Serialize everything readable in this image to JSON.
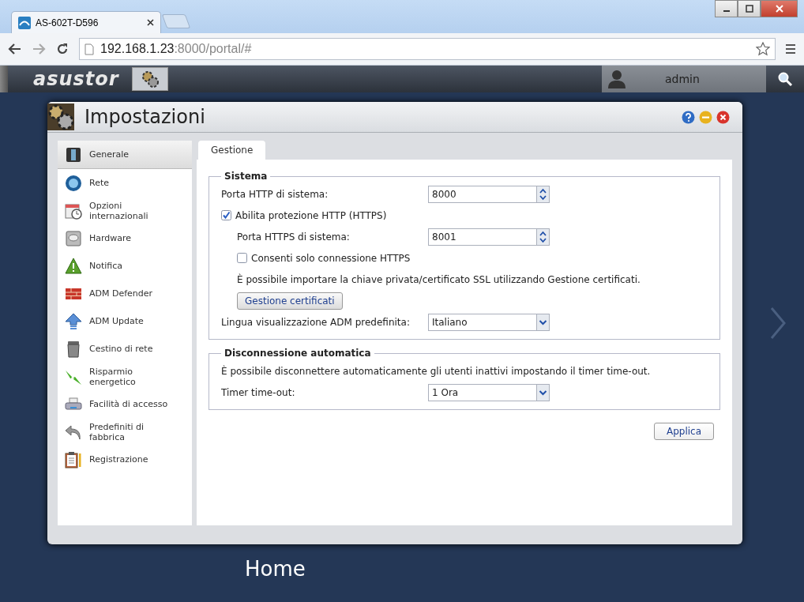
{
  "browser": {
    "tabs": [
      {
        "title": "AS-602T-D596",
        "selected": true
      }
    ],
    "address": {
      "host": "192.168.1.23",
      "path": ":8000/portal/#"
    }
  },
  "topbar": {
    "logo": "asustor",
    "user": "admin"
  },
  "window": {
    "title": "Impostazioni"
  },
  "sidebar": {
    "items": [
      {
        "label": "Generale",
        "kind": "server",
        "selected": true
      },
      {
        "label": "Rete",
        "kind": "globe",
        "selected": false
      },
      {
        "label": "Opzioni internazionali",
        "kind": "calendar",
        "selected": false
      },
      {
        "label": "Hardware",
        "kind": "disk",
        "selected": false
      },
      {
        "label": "Notifica",
        "kind": "warning",
        "selected": false
      },
      {
        "label": "ADM Defender",
        "kind": "wall",
        "selected": false
      },
      {
        "label": "ADM Update",
        "kind": "up",
        "selected": false
      },
      {
        "label": "Cestino di rete",
        "kind": "bin",
        "selected": false
      },
      {
        "label": "Risparmio energetico",
        "kind": "bolt",
        "selected": false
      },
      {
        "label": "Facilità di accesso",
        "kind": "printer",
        "selected": false
      },
      {
        "label": "Predefiniti di fabbrica",
        "kind": "undo",
        "selected": false
      },
      {
        "label": "Registrazione",
        "kind": "clipboard",
        "selected": false
      }
    ]
  },
  "tabs": [
    {
      "label": "Gestione",
      "selected": true
    }
  ],
  "sections": [
    {
      "title": "Sistema",
      "rows": [
        {
          "kind": "spinner",
          "label": "Porta HTTP di sistema:",
          "value": "8000",
          "indent": false
        },
        {
          "kind": "checkbox",
          "label": "Abilita protezione HTTP (HTTPS)",
          "checked": true,
          "indent": false
        },
        {
          "kind": "spinner",
          "label": "Porta HTTPS di sistema:",
          "value": "8001",
          "indent": true
        },
        {
          "kind": "checkbox",
          "label": "Consenti solo connessione HTTPS",
          "checked": false,
          "indent": true
        },
        {
          "kind": "note",
          "text": "È possibile importare la chiave privata/certificato SSL utilizzando Gestione certificati.",
          "indent": true
        },
        {
          "kind": "button",
          "label": "Gestione certificati",
          "indent": true
        },
        {
          "kind": "select",
          "label": "Lingua visualizzazione ADM predefinita:",
          "value": "Italiano",
          "indent": false
        }
      ]
    },
    {
      "title": "Disconnessione automatica",
      "rows": [
        {
          "kind": "note",
          "text": "È possibile disconnettere automaticamente gli utenti inattivi impostando il timer time-out.",
          "indent": false
        },
        {
          "kind": "select",
          "label": "Timer time-out:",
          "value": "1 Ora",
          "indent": false
        }
      ]
    }
  ],
  "apply_button": "Applica",
  "desktop": {
    "label": "Home"
  }
}
